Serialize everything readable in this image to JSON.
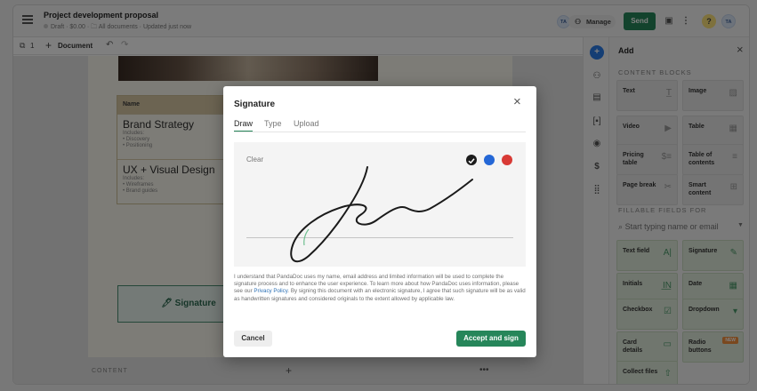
{
  "document": {
    "title": "Project development proposal",
    "status": "Draft",
    "price": "$0.00",
    "folder": "All documents",
    "updated": "Updated just now"
  },
  "header": {
    "avatar_initials": "TA",
    "manage_label": "Manage",
    "send_label": "Send",
    "help_label": "?",
    "user_initials": "TA"
  },
  "toolbar": {
    "page_count": "1",
    "document_label": "Document"
  },
  "content": {
    "table_header": "Name",
    "services": [
      {
        "title": "Brand Strategy",
        "includes": "Includes:",
        "items": [
          "Discovery",
          "Positioning"
        ]
      },
      {
        "title": "UX + Visual Design",
        "includes": "Includes:",
        "items": [
          "Wireframes",
          "Brand guides"
        ]
      }
    ],
    "signature_field_label": "Signature",
    "bottom_label": "CONTENT"
  },
  "panel": {
    "title": "Add",
    "content_blocks_heading": "CONTENT BLOCKS",
    "content_blocks": [
      "Text",
      "Image",
      "Video",
      "Table",
      "Pricing table",
      "Table of contents",
      "Page break",
      "Smart content"
    ],
    "fillable_heading": "FILLABLE FIELDS FOR",
    "search_placeholder": "Start typing name or email",
    "fields": [
      "Text field",
      "Signature",
      "Initials",
      "Date",
      "Checkbox",
      "Dropdown",
      "Card details",
      "Radio buttons",
      "Collect files"
    ],
    "new_badge": "NEW"
  },
  "modal": {
    "title": "Signature",
    "tabs": [
      "Draw",
      "Type",
      "Upload"
    ],
    "active_tab": "Draw",
    "clear_label": "Clear",
    "colors": [
      "#1c1c1c",
      "#2467d6",
      "#d83a35"
    ],
    "legal_before_link": "I understand that PandaDoc uses my name, email address and limited information will be used to complete the signature process and to enhance the user experience. To learn more about how PandaDoc uses information, please see our ",
    "legal_link": "Privacy Policy",
    "legal_after_link": ". By signing this document with an electronic signature, I agree that such signature will be as valid as handwritten signatures and considered originals to the extent allowed by applicable law.",
    "cancel_label": "Cancel",
    "accept_label": "Accept and sign"
  }
}
